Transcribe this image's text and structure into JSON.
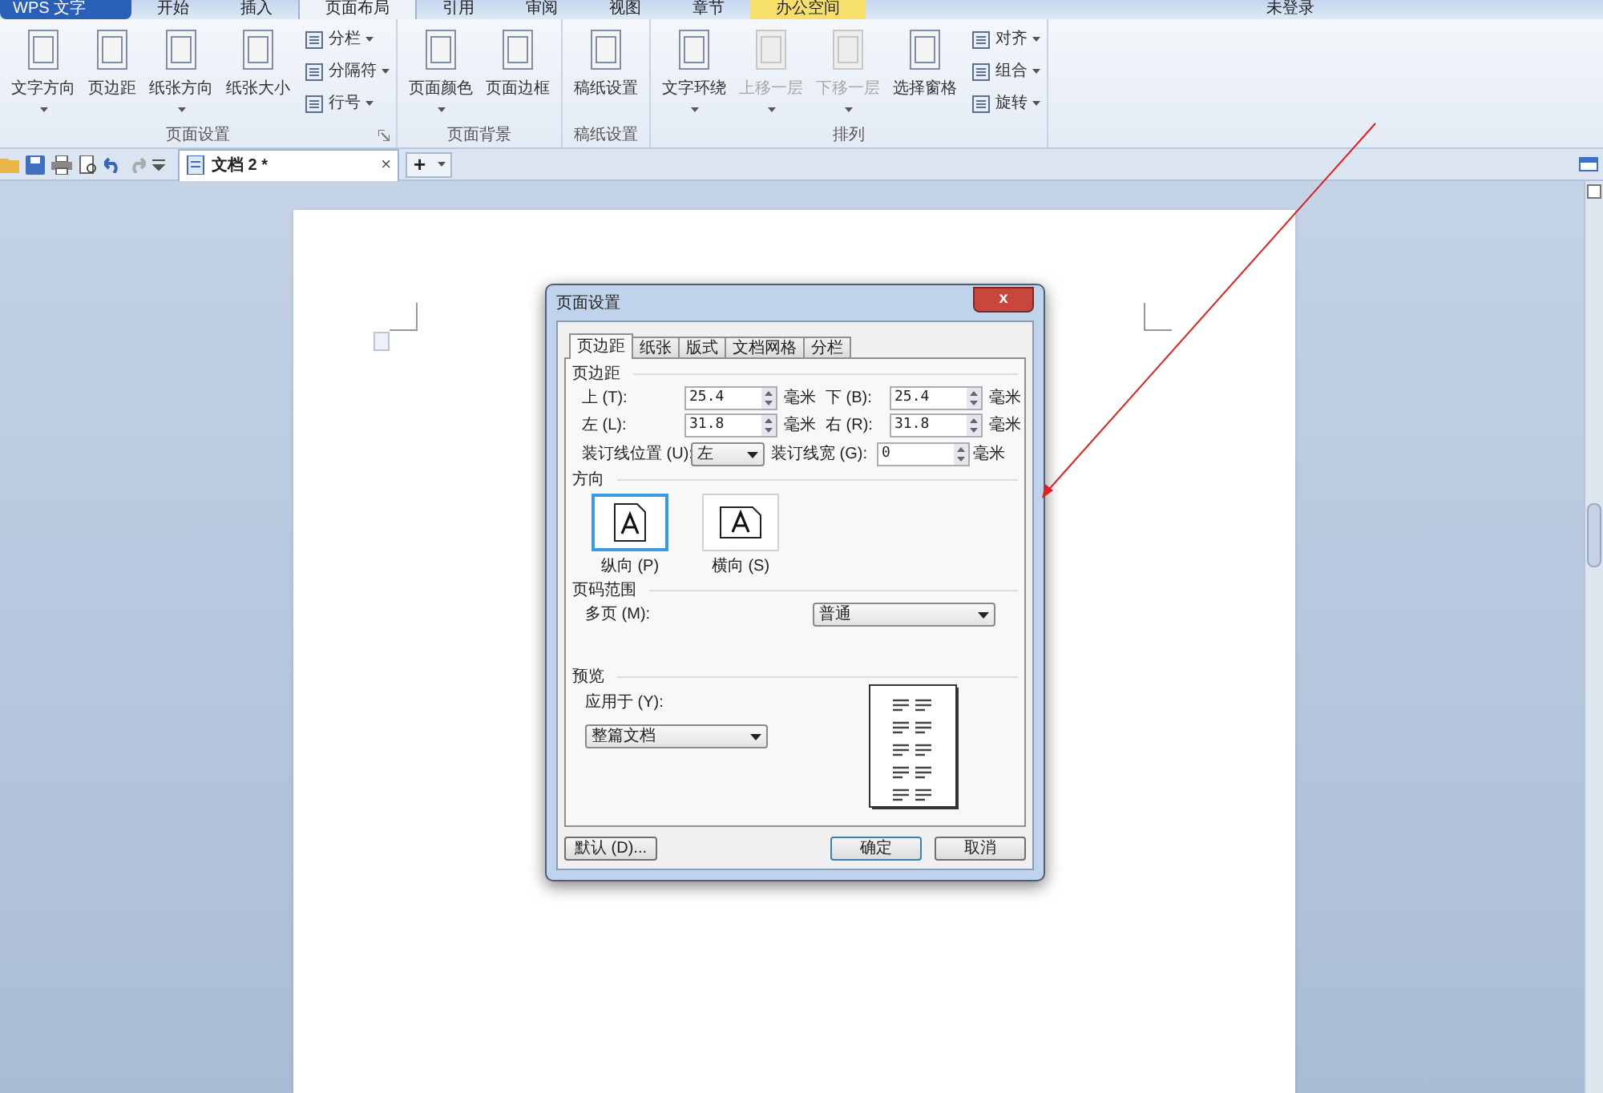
{
  "app_menu": {
    "label": "WPS 文字"
  },
  "menu_tabs": [
    {
      "label": "开始",
      "selected": false
    },
    {
      "label": "插入",
      "selected": false
    },
    {
      "label": "页面布局",
      "selected": true
    },
    {
      "label": "引用",
      "selected": false
    },
    {
      "label": "审阅",
      "selected": false
    },
    {
      "label": "视图",
      "selected": false
    },
    {
      "label": "章节",
      "selected": false
    },
    {
      "label": "办公空间",
      "selected": false,
      "kind": "highlight"
    }
  ],
  "account": {
    "label": "未登录"
  },
  "ribbon": {
    "groups": [
      {
        "label": "页面设置",
        "launcher": true,
        "items": [
          {
            "kind": "large",
            "label": "文字方向",
            "dropdown": true,
            "disabled": false
          },
          {
            "kind": "large",
            "label": "页边距",
            "dropdown": false,
            "disabled": false
          },
          {
            "kind": "large",
            "label": "纸张方向",
            "dropdown": true,
            "disabled": false
          },
          {
            "kind": "large",
            "label": "纸张大小",
            "dropdown": false,
            "disabled": false
          },
          {
            "kind": "small",
            "label": "分栏",
            "dropdown": true,
            "disabled": false
          },
          {
            "kind": "small",
            "label": "分隔符",
            "dropdown": true,
            "disabled": false
          },
          {
            "kind": "small",
            "label": "行号",
            "dropdown": true,
            "disabled": false
          }
        ]
      },
      {
        "label": "页面背景",
        "launcher": false,
        "items": [
          {
            "kind": "large",
            "label": "页面颜色",
            "dropdown": true,
            "disabled": false
          },
          {
            "kind": "large",
            "label": "页面边框",
            "dropdown": false,
            "disabled": false
          }
        ]
      },
      {
        "label": "稿纸设置",
        "launcher": false,
        "items": [
          {
            "kind": "large",
            "label": "稿纸设置",
            "dropdown": false,
            "disabled": false
          }
        ]
      },
      {
        "label": "排列",
        "launcher": false,
        "items": [
          {
            "kind": "large",
            "label": "文字环绕",
            "dropdown": true,
            "disabled": false
          },
          {
            "kind": "large",
            "label": "上移一层",
            "dropdown": true,
            "disabled": true
          },
          {
            "kind": "large",
            "label": "下移一层",
            "dropdown": true,
            "disabled": true
          },
          {
            "kind": "large",
            "label": "选择窗格",
            "dropdown": false,
            "disabled": false
          },
          {
            "kind": "small",
            "label": "对齐",
            "dropdown": true,
            "disabled": false
          },
          {
            "kind": "small",
            "label": "组合",
            "dropdown": true,
            "disabled": false
          },
          {
            "kind": "small",
            "label": "旋转",
            "dropdown": true,
            "disabled": false
          }
        ]
      }
    ]
  },
  "doc_tabs": [
    {
      "label": "文档 2 *",
      "selected": true,
      "close": "×"
    }
  ],
  "new_tab": "+",
  "dialog": {
    "title": "页面设置",
    "close": "x",
    "tabs": [
      {
        "label": "页边距",
        "selected": true
      },
      {
        "label": "纸张",
        "selected": false
      },
      {
        "label": "版式",
        "selected": false
      },
      {
        "label": "文档网格",
        "selected": false
      },
      {
        "label": "分栏",
        "selected": false
      }
    ],
    "margins_section": "页边距",
    "margins": [
      {
        "label": "上 (T):",
        "value": "25.4",
        "unit": "毫米"
      },
      {
        "label": "下 (B):",
        "value": "25.4",
        "unit": "毫米"
      },
      {
        "label": "左 (L):",
        "value": "31.8",
        "unit": "毫米"
      },
      {
        "label": "右 (R):",
        "value": "31.8",
        "unit": "毫米"
      }
    ],
    "gutter_position": {
      "label": "装订线位置 (U):",
      "value": "左"
    },
    "gutter_width": {
      "label": "装订线宽 (G):",
      "value": "0",
      "unit": "毫米"
    },
    "orientation": {
      "label": "方向",
      "options": [
        {
          "label": "纵向 (P)",
          "selected": true,
          "kind": "portrait"
        },
        {
          "label": "横向 (S)",
          "selected": false,
          "kind": "landscape"
        }
      ]
    },
    "pages": {
      "label": "页码范围",
      "field_label": "多页 (M):",
      "value": "普通"
    },
    "preview": {
      "label": "预览",
      "apply_label": "应用于 (Y):",
      "value": "整篇文档"
    },
    "buttons": [
      {
        "label": "默认 (D)...",
        "kind": "default"
      },
      {
        "label": "确定",
        "kind": "primary"
      },
      {
        "label": "取消",
        "kind": "cancel"
      }
    ]
  }
}
